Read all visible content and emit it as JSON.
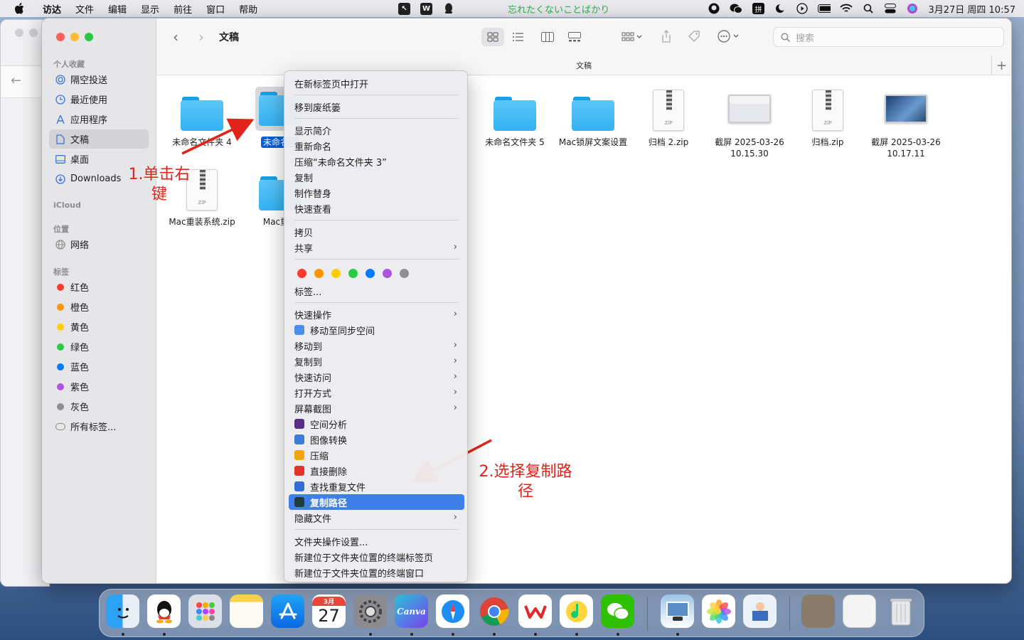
{
  "menubar": {
    "app": "访达",
    "items": [
      "文件",
      "编辑",
      "显示",
      "前往",
      "窗口",
      "帮助"
    ],
    "now_playing": "忘れたくないことばかり",
    "input_method": "拼",
    "clock": "3月27日 周四  10:57"
  },
  "window": {
    "title": "文稿",
    "path_title": "文稿",
    "search_placeholder": "搜索"
  },
  "sidebar": {
    "favorites_header": "个人收藏",
    "favorites": [
      {
        "label": "隔空投送",
        "icon": "airdrop-icon"
      },
      {
        "label": "最近使用",
        "icon": "clock-icon"
      },
      {
        "label": "应用程序",
        "icon": "apps-icon"
      },
      {
        "label": "文稿",
        "icon": "document-icon"
      },
      {
        "label": "桌面",
        "icon": "desktop-icon"
      },
      {
        "label": "Downloads",
        "icon": "download-icon"
      }
    ],
    "icloud_header": "iCloud",
    "locations_header": "位置",
    "locations": [
      {
        "label": "网络",
        "icon": "network-icon"
      }
    ],
    "tags_header": "标签",
    "tags": [
      {
        "label": "红色",
        "color": "#ff3b30"
      },
      {
        "label": "橙色",
        "color": "#ff9500"
      },
      {
        "label": "黄色",
        "color": "#ffcc00"
      },
      {
        "label": "绿色",
        "color": "#28cd41"
      },
      {
        "label": "蓝色",
        "color": "#007aff"
      },
      {
        "label": "紫色",
        "color": "#af52de"
      },
      {
        "label": "灰色",
        "color": "#8e8e93"
      }
    ],
    "all_tags": "所有标签..."
  },
  "files": [
    {
      "name": "未命名文件夹 4",
      "kind": "folder"
    },
    {
      "name": "未命名文",
      "kind": "folder",
      "selected": true
    },
    {
      "name": "未命名文件夹 5",
      "kind": "folder"
    },
    {
      "name": "Mac锁屏文案设置",
      "kind": "folder"
    },
    {
      "name": "归档 2.zip",
      "kind": "zip"
    },
    {
      "name": "截屏 2025-03-26",
      "name2": "10.15.30",
      "kind": "screenshot"
    },
    {
      "name": "归档.zip",
      "kind": "zip"
    },
    {
      "name": "截屏 2025-03-26",
      "name2": "10.17.11",
      "kind": "screenshot"
    },
    {
      "name": "Mac重装系统.zip",
      "kind": "zip"
    },
    {
      "name": "Mac重装",
      "kind": "folder"
    }
  ],
  "zip_badge": "ZIP",
  "context_menu": {
    "g1": [
      "在新标签页中打开"
    ],
    "g2": [
      "移到废纸篓"
    ],
    "g3": [
      "显示简介",
      "重新命名",
      "压缩“未命名文件夹 3”",
      "复制",
      "制作替身",
      "快速查看"
    ],
    "g4": [
      {
        "label": "拷贝"
      },
      {
        "label": "共享",
        "submenu": true
      }
    ],
    "tag_colors": [
      "#ff3b30",
      "#ff9500",
      "#ffcc00",
      "#28cd41",
      "#007aff",
      "#af52de",
      "#8e8e93"
    ],
    "tags_item": "标签...",
    "g5": [
      {
        "label": "快速操作",
        "submenu": true
      },
      {
        "label": "移动至同步空间",
        "icon_color": "#4a8cf0"
      },
      {
        "label": "移动到",
        "submenu": true
      },
      {
        "label": "复制到",
        "submenu": true
      },
      {
        "label": "快速访问",
        "submenu": true
      },
      {
        "label": "打开方式",
        "submenu": true
      },
      {
        "label": "屏幕截图",
        "submenu": true
      },
      {
        "label": "空间分析",
        "icon_color": "#5b2c83"
      },
      {
        "label": "图像转换",
        "icon_color": "#3a7bd5"
      },
      {
        "label": "压缩",
        "icon_color": "#f2a60c"
      },
      {
        "label": "直接删除",
        "icon_color": "#e0342a"
      },
      {
        "label": "查找重复文件",
        "icon_color": "#2f6fd6"
      },
      {
        "label": "复制路径",
        "icon_color": "#1f3d3a",
        "highlighted": true
      },
      {
        "label": "隐藏文件",
        "submenu": true
      }
    ],
    "g6": [
      "文件夹操作设置...",
      "新建位于文件夹位置的终端标签页",
      "新建位于文件夹位置的终端窗口"
    ]
  },
  "annotations": {
    "step1_line1": "1.单击右",
    "step1_line2": "键",
    "step2_line1": "2.选择复制路",
    "step2_line2": "径"
  },
  "dock": {
    "calendar_month": "3月",
    "calendar_day": "27",
    "canva_label": "Canva"
  }
}
